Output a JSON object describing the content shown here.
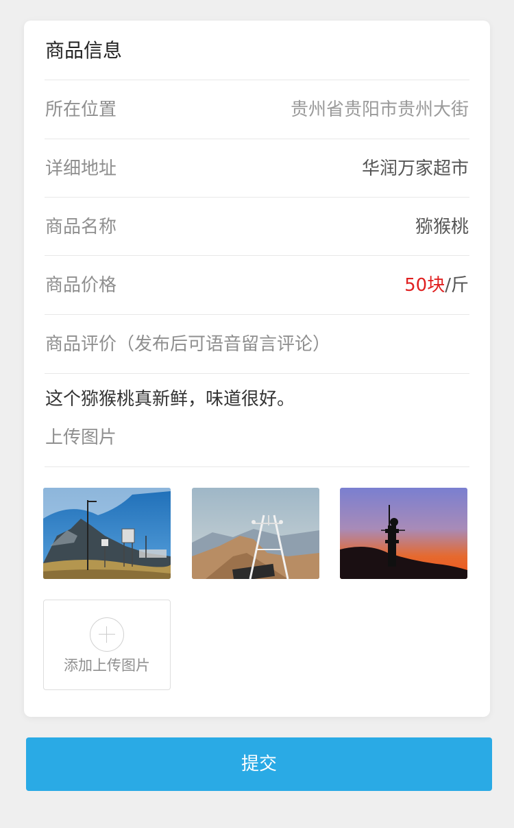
{
  "card": {
    "title": "商品信息",
    "rows": [
      {
        "label": "所在位置",
        "value": "贵州省贵阳市贵州大街"
      },
      {
        "label": "详细地址",
        "value": "华润万家超市"
      },
      {
        "label": "商品名称",
        "value": "猕猴桃"
      },
      {
        "label": "商品价格",
        "price_number": "50块",
        "price_unit": "/斤"
      }
    ],
    "review_label": "商品评价（发布后可语音留言评论）",
    "review_text": "这个猕猴桃真新鲜，味道很好。",
    "upload_label": "上传图片",
    "photos": [
      {
        "icon": "mountain-weather-station-photo"
      },
      {
        "icon": "mountain-sensor-mast-photo"
      },
      {
        "icon": "sunset-tower-photo"
      }
    ],
    "add_photo_label": "添加上传图片"
  },
  "submit_label": "提交",
  "colors": {
    "accent": "#2aaae5",
    "price": "#e02020",
    "background": "#efefef"
  }
}
